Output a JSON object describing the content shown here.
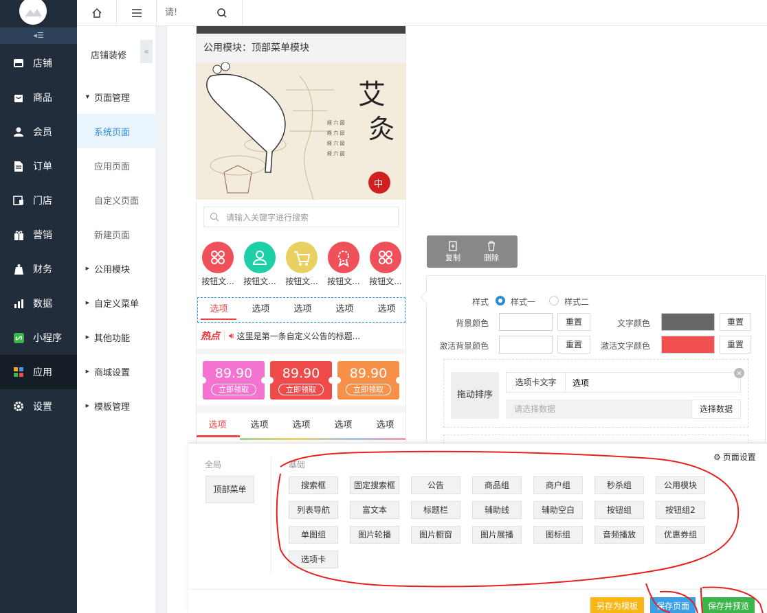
{
  "search": {
    "placeholder": "请!"
  },
  "nav": {
    "items": [
      {
        "label": "店铺",
        "icon": "store-icon"
      },
      {
        "label": "商品",
        "icon": "bag-icon"
      },
      {
        "label": "会员",
        "icon": "user-icon"
      },
      {
        "label": "订单",
        "icon": "document-icon"
      },
      {
        "label": "门店",
        "icon": "shop-icon"
      },
      {
        "label": "营销",
        "icon": "gift-icon"
      },
      {
        "label": "财务",
        "icon": "money-icon"
      },
      {
        "label": "数据",
        "icon": "chart-icon"
      },
      {
        "label": "小程序",
        "icon": "miniprogram-icon"
      },
      {
        "label": "应用",
        "icon": "apps-icon"
      },
      {
        "label": "设置",
        "icon": "gear-icon"
      }
    ]
  },
  "subnav": {
    "title": "店铺装修",
    "items": [
      {
        "label": "页面管理"
      },
      {
        "label": "系统页面"
      },
      {
        "label": "应用页面"
      },
      {
        "label": "自定义页面"
      },
      {
        "label": "新建页面"
      },
      {
        "label": "公用模块"
      },
      {
        "label": "自定义菜单"
      },
      {
        "label": "其他功能"
      },
      {
        "label": "商城设置"
      },
      {
        "label": "模板管理"
      }
    ]
  },
  "phone": {
    "module_title": "公用模块：顶部菜单模块",
    "search_placeholder": "请输入关键字进行搜索",
    "buttons": [
      "按钮文...",
      "按钮文...",
      "按钮文...",
      "按钮文...",
      "按钮文..."
    ],
    "button_colors": [
      "#f0505a",
      "#1ecfa8",
      "#ead060",
      "#f0505a",
      "#f0505a"
    ],
    "tabs": [
      "选项",
      "选项",
      "选项",
      "选项",
      "选项"
    ],
    "notice_tag": "热点",
    "notice_text": "这里是第一条自定义公告的标题...",
    "coupons": [
      {
        "price": "89.90",
        "label": "立即领取",
        "color": "#f472d0"
      },
      {
        "price": "89.90",
        "label": "立即领取",
        "color": "#f04b4b"
      },
      {
        "price": "89.90",
        "label": "立即领取",
        "color": "#f7914a"
      }
    ],
    "tabs2": [
      "选项",
      "选项",
      "选项",
      "选项",
      "选项"
    ]
  },
  "actions": {
    "copy": "复制",
    "delete": "删除"
  },
  "settings": {
    "style_label": "样式",
    "style_options": [
      "样式一",
      "样式二"
    ],
    "bg_color_label": "背景颜色",
    "text_color_label": "文字颜色",
    "active_bg_label": "激活背景颜色",
    "active_text_label": "激活文字颜色",
    "reset": "重置",
    "text_color": "#666666",
    "active_text_color": "#f05050",
    "drag_sort": "拖动排序",
    "tab_text_label": "选项卡文字",
    "tab_text_value": "选项",
    "data_placeholder": "请选择数据",
    "select_data": "选择数据"
  },
  "panel": {
    "global_label": "全局",
    "global_items": [
      "顶部菜单"
    ],
    "basic_label": "基础",
    "page_settings": "页面设置",
    "modules": [
      "搜索框",
      "固定搜索框",
      "公告",
      "商品组",
      "商户组",
      "秒杀组",
      "公用模块",
      "列表导航",
      "富文本",
      "标题栏",
      "辅助线",
      "辅助空白",
      "按钮组",
      "按钮组2",
      "单图组",
      "图片轮播",
      "图片橱窗",
      "图片展播",
      "图标组",
      "音频播放",
      "优惠券组",
      "选项卡"
    ],
    "save_template": "另存为模板",
    "save_page": "保存页面",
    "save_preview": "保存并预览"
  },
  "colors": {
    "accent": "#2b8bd4",
    "nav_bg": "#222d3c",
    "red": "#f04b4b"
  }
}
